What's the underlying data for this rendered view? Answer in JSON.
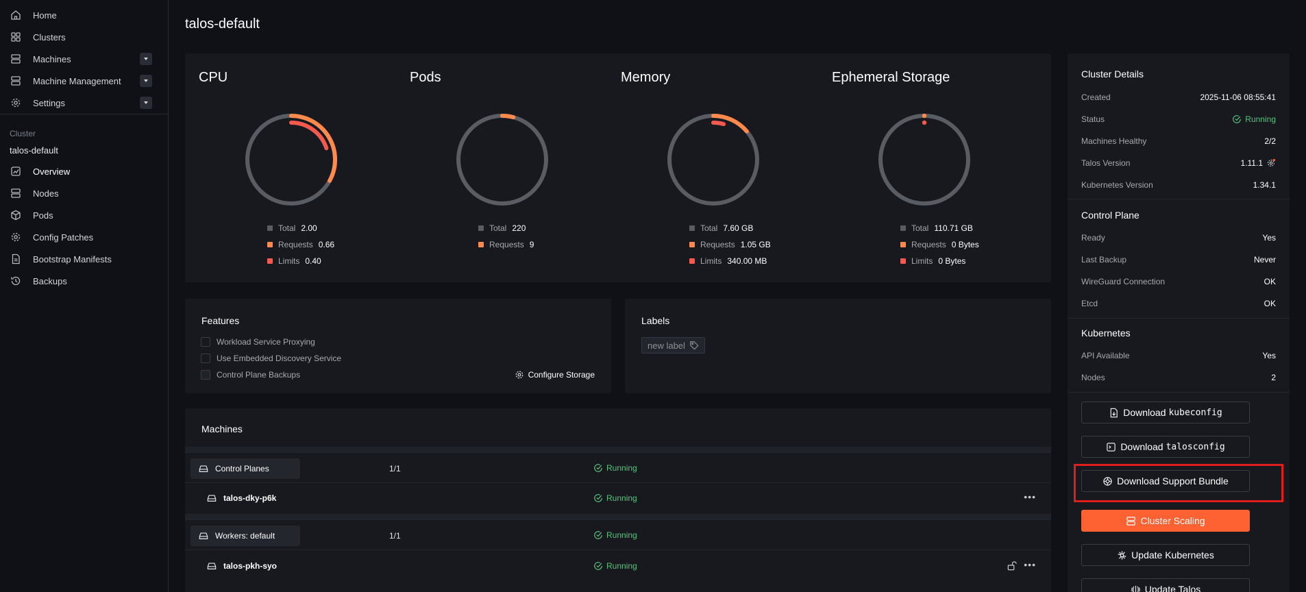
{
  "sidebar": {
    "items": [
      {
        "label": "Home",
        "icon": "home-icon"
      },
      {
        "label": "Clusters",
        "icon": "grid-icon"
      },
      {
        "label": "Machines",
        "icon": "server-icon"
      },
      {
        "label": "Machine Management",
        "icon": "server-icon"
      },
      {
        "label": "Settings",
        "icon": "gear-icon"
      }
    ],
    "cluster_section_label": "Cluster",
    "cluster_name": "talos-default",
    "cluster_items": [
      {
        "label": "Overview",
        "icon": "chart-icon"
      },
      {
        "label": "Nodes",
        "icon": "server-icon"
      },
      {
        "label": "Pods",
        "icon": "cube-icon"
      },
      {
        "label": "Config Patches",
        "icon": "gear-icon"
      },
      {
        "label": "Bootstrap Manifests",
        "icon": "document-icon"
      },
      {
        "label": "Backups",
        "icon": "history-icon"
      }
    ]
  },
  "page": {
    "title": "talos-default"
  },
  "colors": {
    "total": "#5a5c64",
    "requests": "#ff8a4c",
    "limits": "#f5594e",
    "running": "#58c27d",
    "accent": "#ff6232"
  },
  "metrics": [
    {
      "title": "CPU",
      "total_fraction": 1,
      "requests_fraction": 0.33,
      "limits_fraction": 0.2,
      "legend": [
        {
          "label": "Total",
          "value": "2.00"
        },
        {
          "label": "Requests",
          "value": "0.66"
        },
        {
          "label": "Limits",
          "value": "0.40"
        }
      ]
    },
    {
      "title": "Pods",
      "total_fraction": 1,
      "requests_fraction": 0.041,
      "limits_fraction": 0,
      "legend": [
        {
          "label": "Total",
          "value": "220"
        },
        {
          "label": "Requests",
          "value": "9"
        }
      ]
    },
    {
      "title": "Memory",
      "total_fraction": 1,
      "requests_fraction": 0.138,
      "limits_fraction": 0.045,
      "legend": [
        {
          "label": "Total",
          "value": "7.60 GB"
        },
        {
          "label": "Requests",
          "value": "1.05 GB"
        },
        {
          "label": "Limits",
          "value": "340.00 MB"
        }
      ]
    },
    {
      "title": "Ephemeral Storage",
      "total_fraction": 1,
      "requests_fraction": 0,
      "limits_fraction": 0,
      "legend": [
        {
          "label": "Total",
          "value": "110.71 GB"
        },
        {
          "label": "Requests",
          "value": "0 Bytes"
        },
        {
          "label": "Limits",
          "value": "0 Bytes"
        }
      ]
    }
  ],
  "features": {
    "title": "Features",
    "items": [
      "Workload Service Proxying",
      "Use Embedded Discovery Service",
      "Control Plane Backups"
    ],
    "configure_storage": "Configure Storage"
  },
  "labels": {
    "title": "Labels",
    "new_label": "new label"
  },
  "machines": {
    "title": "Machines",
    "groups": [
      {
        "name": "Control Planes",
        "count": "1/1",
        "status": "Running",
        "machines": [
          {
            "name": "talos-dky-p6k",
            "status": "Running",
            "locked": false
          }
        ]
      },
      {
        "name": "Workers: default",
        "count": "1/1",
        "status": "Running",
        "machines": [
          {
            "name": "talos-pkh-syo",
            "status": "Running",
            "locked": true
          }
        ]
      }
    ]
  },
  "details": {
    "title": "Cluster Details",
    "rows": [
      {
        "k": "Created",
        "v": "2025-11-06 08:55:41"
      },
      {
        "k": "Status",
        "v": "Running"
      },
      {
        "k": "Machines Healthy",
        "v": "2/2"
      },
      {
        "k": "Talos Version",
        "v": "1.11.1"
      },
      {
        "k": "Kubernetes Version",
        "v": "1.34.1"
      }
    ],
    "control_plane_title": "Control Plane",
    "control_plane": [
      {
        "k": "Ready",
        "v": "Yes"
      },
      {
        "k": "Last Backup",
        "v": "Never"
      },
      {
        "k": "WireGuard Connection",
        "v": "OK"
      },
      {
        "k": "Etcd",
        "v": "OK"
      }
    ],
    "kubernetes_title": "Kubernetes",
    "kubernetes": [
      {
        "k": "API Available",
        "v": "Yes"
      },
      {
        "k": "Nodes",
        "v": "2"
      }
    ]
  },
  "actions": {
    "download_kubeconfig": {
      "label": "Download",
      "mono": "kubeconfig"
    },
    "download_talosconfig": {
      "label": "Download",
      "mono": "talosconfig"
    },
    "download_support_bundle": "Download Support Bundle",
    "cluster_scaling": "Cluster Scaling",
    "update_kubernetes": "Update Kubernetes",
    "update_talos": "Update Talos"
  }
}
